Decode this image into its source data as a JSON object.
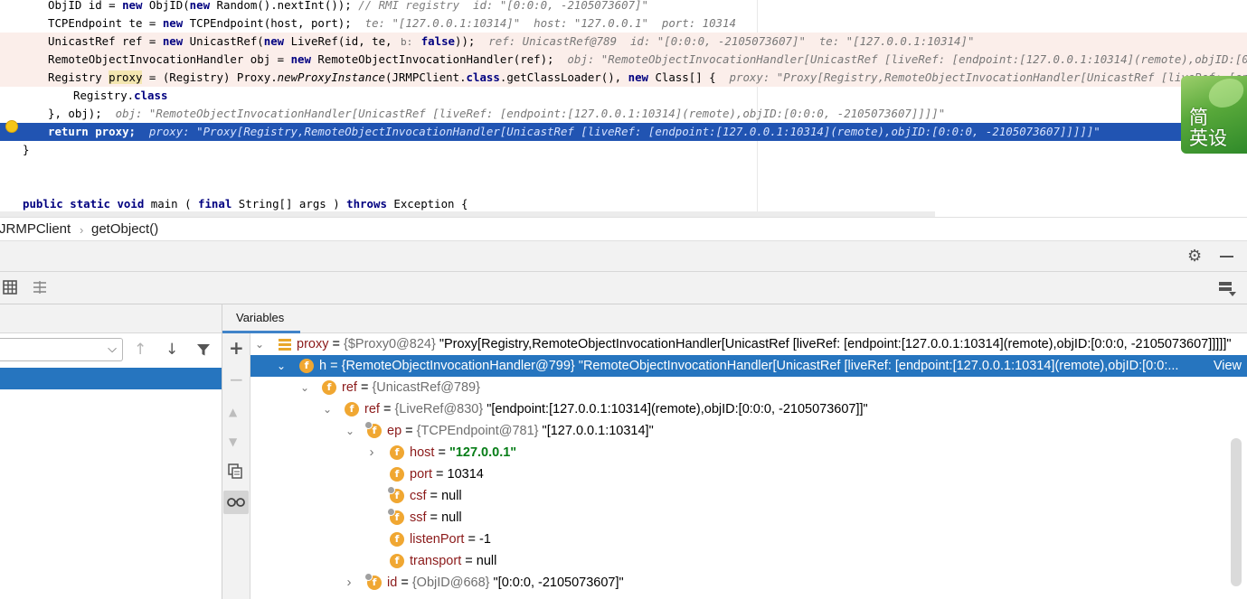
{
  "editor": {
    "lines": [
      {
        "code": "ObjID id = new ObjID(new Random().nextInt()); ",
        "comment": "// RMI registry",
        "hint": "  id: \"[0:0:0, -2105073607]\""
      },
      {
        "code": "TCPEndpoint te = new TCPEndpoint(host, port);",
        "hint": "  te: \"[127.0.0.1:10314]\"  host: \"127.0.0.1\"  port: 10314"
      },
      {
        "code": "UnicastRef ref = new UnicastRef(new LiveRef(id, te, ",
        "param_hint": "b:",
        "code2": " false));",
        "hint": "  ref: UnicastRef@789  id: \"[0:0:0, -2105073607]\"  te: \"[127.0.0.1:10314]\""
      },
      {
        "code": "RemoteObjectInvocationHandler obj = new RemoteObjectInvocationHandler(ref);",
        "hint": "  obj: \"RemoteObjectInvocationHandler[UnicastRef [liveRef: [endpoint:[127.0.0.1:10314](remote),objID:[0:0:0, -2105073607]]]]\""
      },
      {
        "code_a": "Registry ",
        "code_var": "proxy",
        "code_b": " = (Registry) Proxy.",
        "code_method": "newProxyInstance",
        "code_c": "(JRMPClient.class.getClassLoader(), new Class[] {",
        "hint": "  proxy: \"Proxy[Registry,RemoteObjectInvocationHandler[UnicastRef [liveRef: [endpoint:[127.0.0.1:10314](remote),objID:[0:0:0, -2105073607]]]]]\""
      },
      {
        "code": "Registry.class"
      },
      {
        "code": "}, obj);",
        "hint": "  obj: \"RemoteObjectInvocationHandler[UnicastRef [liveRef: [endpoint:[127.0.0.1:10314](remote),objID:[0:0:0, -2105073607]]]]\""
      },
      {
        "code": "return proxy;",
        "hint": "  proxy: \"Proxy[Registry,RemoteObjectInvocationHandler[UnicastRef [liveRef: [endpoint:[127.0.0.1:10314](remote),objID:[0:0:0, -2105073607]]]]]\""
      },
      {
        "code": "}"
      },
      {
        "code": "public static void main ( final String[] args ) throws Exception {"
      }
    ]
  },
  "ime_badge": {
    "line1": "简",
    "line2": "英设"
  },
  "breadcrumb": {
    "class_name": "JRMPClient",
    "separator": "›",
    "method": "getObject()"
  },
  "debug": {
    "tab_label": "Variables"
  },
  "icons": {
    "gear": "gear-icon",
    "minimize": "minimize-icon",
    "table": "table-icon",
    "layout": "layout-icon",
    "settings_right": "layout-settings-icon",
    "add": "add-icon",
    "remove": "remove-icon",
    "up": "arrow-up-icon",
    "down": "arrow-down-icon",
    "filter": "filter-icon",
    "copy": "copy-icon",
    "glasses": "glasses-icon"
  },
  "variables": [
    {
      "name": "proxy",
      "type": "{$Proxy0@824}",
      "value": "\"Proxy[Registry,RemoteObjectInvocationHandler[UnicastRef [liveRef: [endpoint:[127.0.0.1:10314](remote),objID:[0:0:0, -2105073607]]]]]\"",
      "expander": "⌄"
    },
    {
      "name": "h",
      "type": "{RemoteObjectInvocationHandler@799}",
      "value": "\"RemoteObjectInvocationHandler[UnicastRef [liveRef: [endpoint:[127.0.0.1:10314](remote),objID:[0:0:...",
      "link": "View",
      "expander": "⌄"
    },
    {
      "name": "ref",
      "type": "{UnicastRef@789}",
      "value": "",
      "expander": "⌄"
    },
    {
      "name": "ref",
      "type": "{LiveRef@830}",
      "value": "\"[endpoint:[127.0.0.1:10314](remote),objID:[0:0:0, -2105073607]]\"",
      "expander": "⌄"
    },
    {
      "name": "ep",
      "type": "{TCPEndpoint@781}",
      "value": "\"[127.0.0.1:10314]\"",
      "expander": "⌄"
    },
    {
      "name": "host",
      "eq": " = ",
      "str_value": "\"127.0.0.1\"",
      "expander": "›"
    },
    {
      "name": "port",
      "eq": " = ",
      "plain_value": "10314"
    },
    {
      "name": "csf",
      "eq": " = ",
      "plain_value": "null"
    },
    {
      "name": "ssf",
      "eq": " = ",
      "plain_value": "null"
    },
    {
      "name": "listenPort",
      "eq": " = ",
      "plain_value": "-1"
    },
    {
      "name": "transport",
      "eq": " = ",
      "plain_value": "null"
    },
    {
      "name": "id",
      "type": "{ObjID@668}",
      "value": "\"[0:0:0, -2105073607]\"",
      "expander": "›"
    }
  ]
}
